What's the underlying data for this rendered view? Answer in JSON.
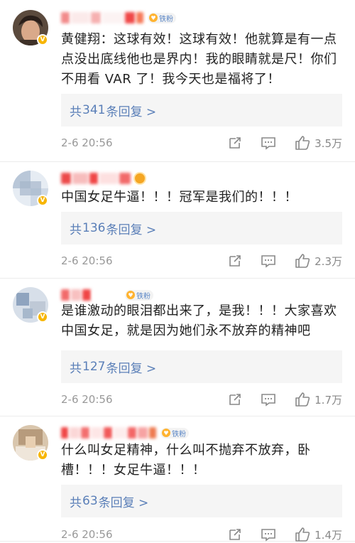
{
  "comments": [
    {
      "badge": "V",
      "fan_label": "铁粉",
      "text": "黄健翔：这球有效！这球有效！他就算是有一点点没出底线他也是界内！我的眼睛就是尺！你们不用看 VAR 了！我今天也是福将了！",
      "reply_prefix": "共",
      "reply_count": "341",
      "reply_suffix": "条回复 >",
      "time": "2-6 20:56",
      "likes": "3.5万"
    },
    {
      "badge": "V",
      "text": "中国女足牛逼！！！冠军是我们的！！！",
      "reply_prefix": "共",
      "reply_count": "136",
      "reply_suffix": "条回复 >",
      "time": "2-6 20:56",
      "likes": "2.3万"
    },
    {
      "badge": "V",
      "fan_label": "铁粉",
      "text": "是谁激动的眼泪都出来了，是我！！！大家喜欢中国女足，就是因为她们永不放弃的精神吧",
      "reply_prefix": "共",
      "reply_count": "127",
      "reply_suffix": "条回复 >",
      "time": "2-6 20:56",
      "likes": "1.7万"
    },
    {
      "badge": "V",
      "fan_label": "铁粉",
      "text": "什么叫女足精神，什么叫不抛弃不放弃，卧槽！！！女足牛逼！！！",
      "reply_prefix": "共",
      "reply_count": "63",
      "reply_suffix": "条回复 >",
      "time": "2-6 20:56",
      "likes": "1.4万"
    }
  ],
  "colors": {
    "link": "#5a7fb8",
    "meta": "#999999",
    "reply_bg": "#f5f5f5",
    "fan_badge_text": "#5c87c6"
  },
  "icons": [
    "repost-icon",
    "comment-icon",
    "like-icon"
  ]
}
